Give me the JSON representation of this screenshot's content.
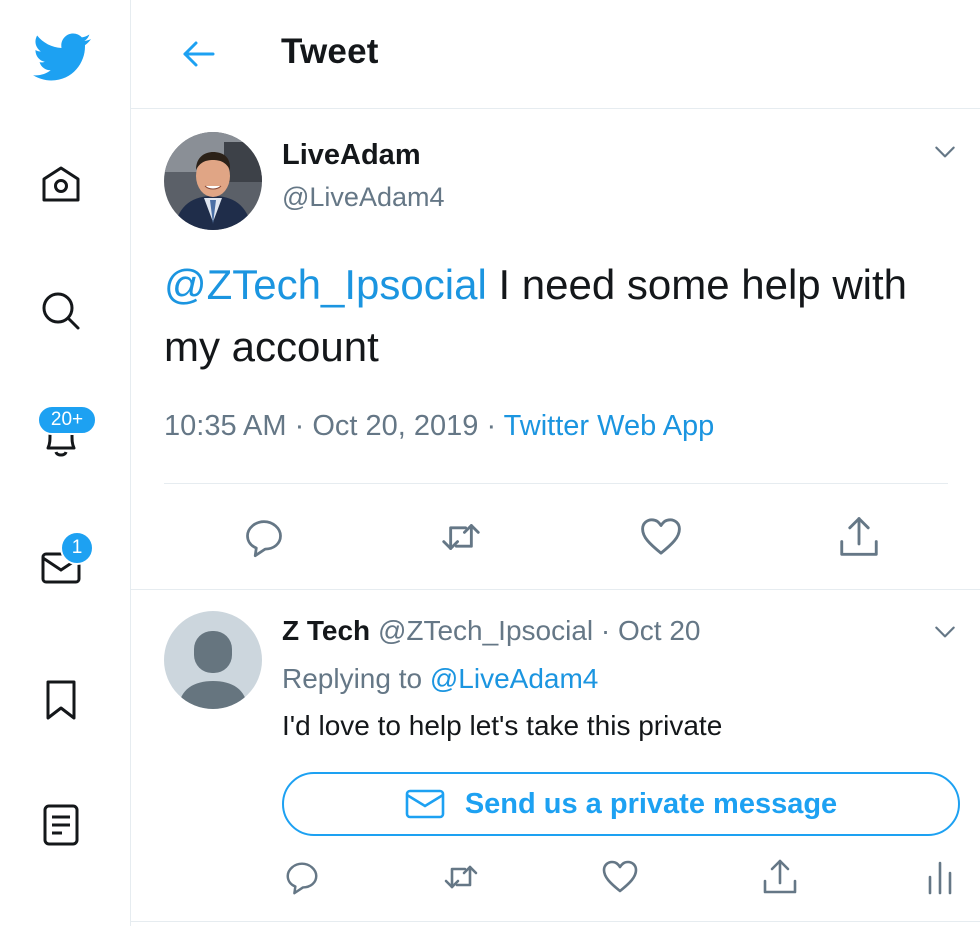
{
  "header": {
    "title": "Tweet"
  },
  "sidebar": {
    "notifications_badge": "20+",
    "messages_badge": "1"
  },
  "tweet": {
    "display_name": "LiveAdam",
    "handle": "@LiveAdam4",
    "mention": "@ZTech_Ipsocial",
    "text": " I need some help with my account",
    "time": "10:35 AM",
    "date": "Oct 20, 2019",
    "dot": "·",
    "source": "Twitter Web App"
  },
  "reply": {
    "display_name": "Z Tech",
    "handle": "@ZTech_Ipsocial",
    "dot": "·",
    "date": "Oct 20",
    "replying_prefix": "Replying to ",
    "replying_handle": "@LiveAdam4",
    "text": "I'd love to help let's take this private",
    "dm_button_label": "Send us a private message"
  },
  "colors": {
    "accent": "#1da1f2",
    "link": "#1b95e0",
    "muted": "#657786",
    "icon": "#14171a"
  },
  "icons": {
    "sidebar": [
      "twitter-logo",
      "home-icon",
      "search-icon",
      "bell-icon",
      "mail-icon",
      "bookmark-icon",
      "list-icon"
    ],
    "actions": [
      "reply-icon",
      "retweet-icon",
      "like-icon",
      "share-icon",
      "analytics-icon"
    ]
  }
}
